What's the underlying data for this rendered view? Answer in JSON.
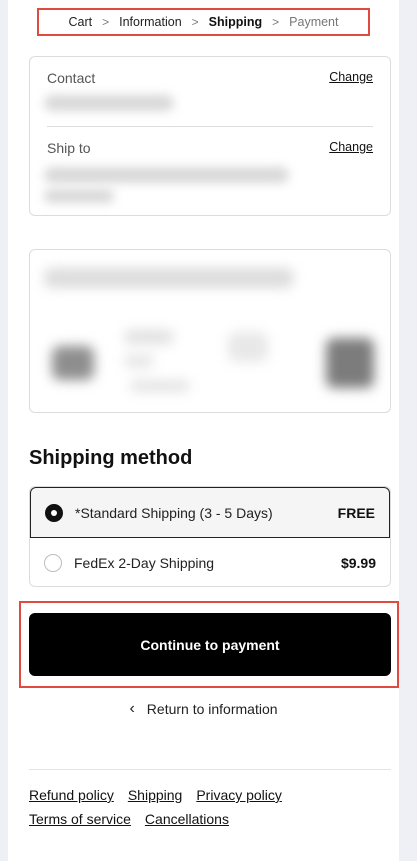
{
  "breadcrumb": {
    "items": [
      "Cart",
      "Information",
      "Shipping",
      "Payment"
    ],
    "separator": ">"
  },
  "contact": {
    "label": "Contact",
    "change_label": "Change"
  },
  "ship_to": {
    "label": "Ship to",
    "change_label": "Change"
  },
  "shipping_method": {
    "title": "Shipping method",
    "options": [
      {
        "name": "*Standard Shipping (3 - 5 Days)",
        "price": "FREE",
        "selected": true
      },
      {
        "name": "FedEx 2-Day Shipping",
        "price": "$9.99",
        "selected": false
      }
    ]
  },
  "actions": {
    "continue_label": "Continue to payment",
    "return_label": "Return to information"
  },
  "footer": {
    "links": [
      "Refund policy",
      "Shipping",
      "Privacy policy",
      "Terms of service",
      "Cancellations"
    ]
  },
  "colors": {
    "annotation": "#e04a3f",
    "button_bg": "#000000",
    "page_bg": "#eef0f5"
  },
  "icons": {
    "breadcrumb_separator": "chevron-right-icon",
    "return": "chevron-left-icon",
    "radio_selected": "radio-selected-icon",
    "radio_unselected": "radio-unselected-icon"
  }
}
